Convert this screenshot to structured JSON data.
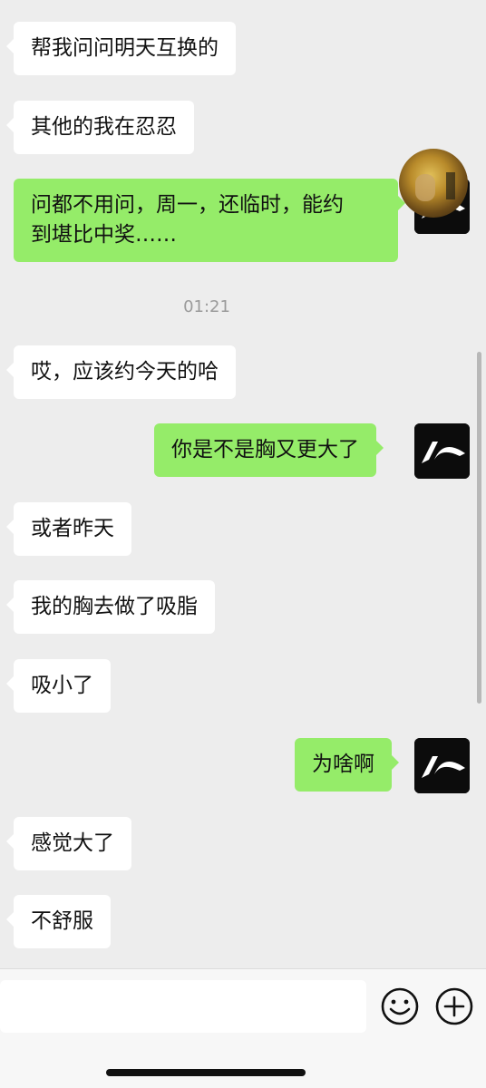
{
  "conversation": {
    "messages": [
      {
        "side": "received",
        "text": "帮我问问明天互换的"
      },
      {
        "side": "received",
        "text": "其他的我在忍忍"
      },
      {
        "side": "sent",
        "text": "问都不用问，周一，还临时，能约\n到堪比中奖……",
        "avatar": "gold-painting-avatar"
      },
      {
        "side": "received",
        "text": "哎，应该约今天的哈"
      },
      {
        "side": "sent",
        "text": "你是不是胸又更大了",
        "avatar": "black-swoosh-avatar"
      },
      {
        "side": "received",
        "text": "或者昨天"
      },
      {
        "side": "received",
        "text": "我的胸去做了吸脂"
      },
      {
        "side": "received",
        "text": "吸小了"
      },
      {
        "side": "sent",
        "text": "为啥啊",
        "avatar": "black-swoosh-avatar"
      },
      {
        "side": "received",
        "text": "感觉大了"
      },
      {
        "side": "received",
        "text": "不舒服"
      }
    ],
    "timestamp": "01:21"
  },
  "input_bar": {
    "message_value": "",
    "emoji_icon": "smiley-face-icon",
    "more_icon": "plus-circle-icon"
  },
  "colors": {
    "background": "#ededed",
    "sent_bubble": "#95ec69",
    "received_bubble": "#ffffff",
    "timestamp_text": "#9a9a9a"
  }
}
